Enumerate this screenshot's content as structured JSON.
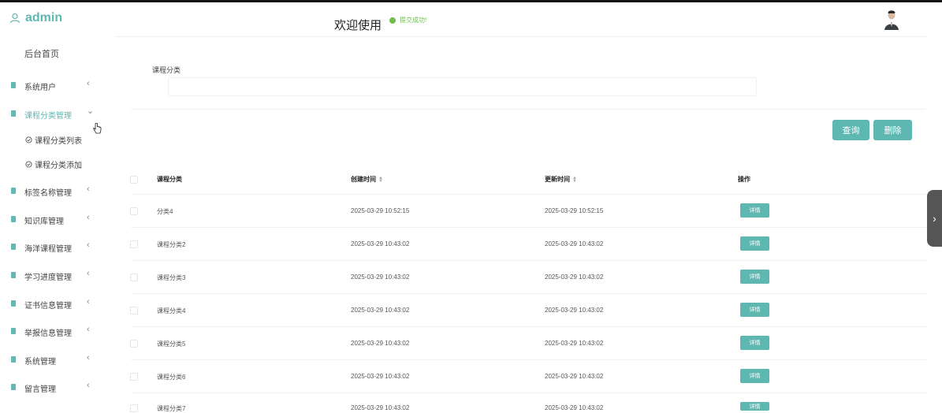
{
  "brand": {
    "name": "admin"
  },
  "header": {
    "welcome": "欢迎使用",
    "toast": "提交成功!"
  },
  "sidebar": {
    "home": "后台首页",
    "items": [
      {
        "label": "系统用户",
        "chevron": "‹",
        "active": false
      },
      {
        "label": "课程分类管理",
        "chevron": "⌄",
        "active": true
      },
      {
        "label": "标签名称管理",
        "chevron": "‹",
        "active": false
      },
      {
        "label": "知识库管理",
        "chevron": "‹",
        "active": false
      },
      {
        "label": "海洋课程管理",
        "chevron": "‹",
        "active": false
      },
      {
        "label": "学习进度管理",
        "chevron": "‹",
        "active": false
      },
      {
        "label": "证书信息管理",
        "chevron": "‹",
        "active": false
      },
      {
        "label": "举报信息管理",
        "chevron": "‹",
        "active": false
      },
      {
        "label": "系统管理",
        "chevron": "‹",
        "active": false
      },
      {
        "label": "留言管理",
        "chevron": "‹",
        "active": false
      }
    ],
    "submenu": [
      {
        "label": "课程分类列表"
      },
      {
        "label": "课程分类添加"
      }
    ]
  },
  "search": {
    "label": "课程分类",
    "value": "",
    "placeholder": ""
  },
  "buttons": {
    "query": "查询",
    "delete": "删除"
  },
  "table": {
    "columns": [
      "课程分类",
      "创建时间",
      "更新时间",
      "操作"
    ],
    "rows": [
      {
        "name": "分类4",
        "created": "2025-03-29 10:52:15",
        "updated": "2025-03-29 10:52:15",
        "action": "详情"
      },
      {
        "name": "课程分类2",
        "created": "2025-03-29 10:43:02",
        "updated": "2025-03-29 10:43:02",
        "action": "详情"
      },
      {
        "name": "课程分类3",
        "created": "2025-03-29 10:43:02",
        "updated": "2025-03-29 10:43:02",
        "action": "详情"
      },
      {
        "name": "课程分类4",
        "created": "2025-03-29 10:43:02",
        "updated": "2025-03-29 10:43:02",
        "action": "详情"
      },
      {
        "name": "课程分类5",
        "created": "2025-03-29 10:43:02",
        "updated": "2025-03-29 10:43:02",
        "action": "详情"
      },
      {
        "name": "课程分类6",
        "created": "2025-03-29 10:43:02",
        "updated": "2025-03-29 10:43:02",
        "action": "详情"
      },
      {
        "name": "课程分类7",
        "created": "2025-03-29 10:43:02",
        "updated": "2025-03-29 10:43:02",
        "action": "详情"
      }
    ]
  },
  "colors": {
    "accent": "#5fb7b2",
    "success": "#6dbf4b"
  },
  "icons": {
    "user": "user-icon",
    "doc": "doc-icon",
    "check": "circle-check-icon",
    "sort": "sort-icon",
    "handle": "chevron-right-icon"
  }
}
